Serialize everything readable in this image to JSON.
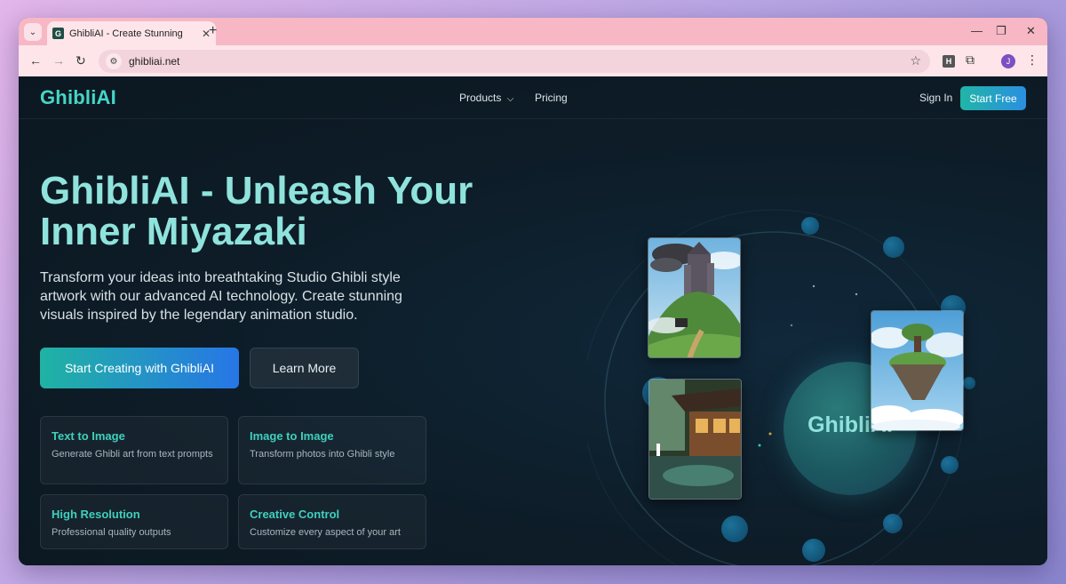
{
  "browser": {
    "tab_title": "GhibliAI - Create Stunning Studio",
    "favicon_letter": "G",
    "url": "ghibliai.net",
    "extension_letter": "H",
    "profile_initial": "J",
    "icons": [
      "tab-search-icon",
      "close-icon",
      "new-tab-icon",
      "minimize-icon",
      "restore-icon",
      "back-icon",
      "forward-icon",
      "reload-icon",
      "site-info-icon",
      "star-icon",
      "extensions-icon",
      "menu-icon"
    ]
  },
  "site": {
    "logo": "GhibliAI",
    "nav": {
      "products": "Products",
      "pricing": "Pricing",
      "sign_in": "Sign In",
      "start_free": "Start Free"
    },
    "hero": {
      "title": "GhibliAI - Unleash Your Inner Miyazaki",
      "subtitle": "Transform your ideas into breathtaking Studio Ghibli style artwork with our advanced AI technology. Create stunning visuals inspired by the legendary animation studio.",
      "primary_cta": "Start Creating with GhibliAI",
      "secondary_cta": "Learn More"
    },
    "features": [
      {
        "title": "Text to Image",
        "desc": "Generate Ghibli art from text prompts"
      },
      {
        "title": "Image to Image",
        "desc": "Transform photos into Ghibli style"
      },
      {
        "title": "High Resolution",
        "desc": "Professional quality outputs"
      },
      {
        "title": "Creative Control",
        "desc": "Customize every aspect of your art"
      }
    ],
    "visual_label": "GhibliAI"
  },
  "colors": {
    "accent": "#46d6c8",
    "tab_strip": "#f7b7c5",
    "page_bg": "#0d1c27"
  }
}
